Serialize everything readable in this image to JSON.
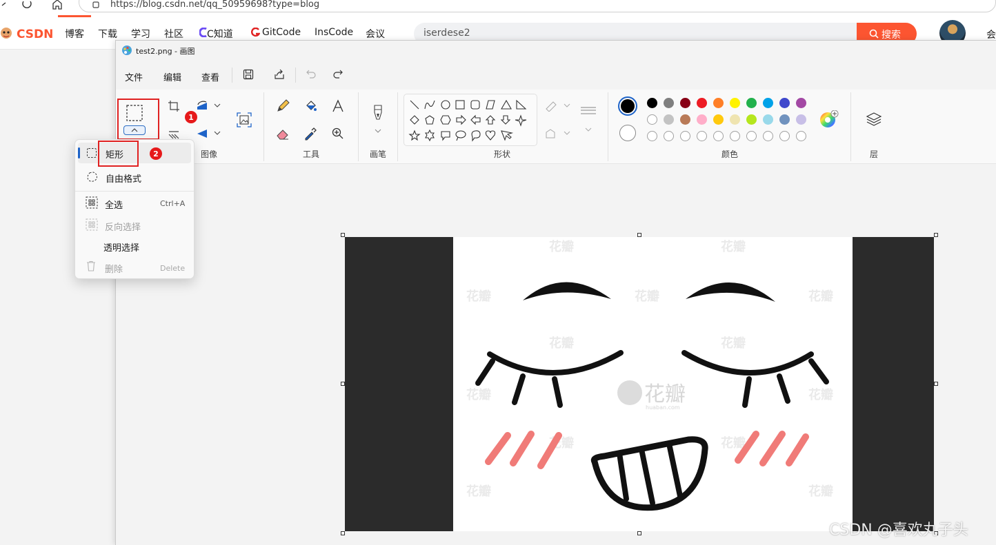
{
  "browser": {
    "url": "https://blog.csdn.net/qq_50959698?type=blog"
  },
  "csdn": {
    "logo_text": "CSDN",
    "nav": [
      "博客",
      "下载",
      "学习",
      "社区",
      "C知道",
      "GitCode",
      "InsCode",
      "会议"
    ],
    "search_value": "iserdese2",
    "search_button": "搜索",
    "right_item": "会",
    "accent_color": "#fc5531"
  },
  "paint": {
    "title": "test2.png - 画图",
    "menus": [
      "文件",
      "编辑",
      "查看"
    ],
    "groups": {
      "image": "图像",
      "tools": "工具",
      "brushes": "画笔",
      "shapes": "形状",
      "colors": "颜色",
      "layers": "层"
    },
    "colors_row1": [
      "#000000",
      "#7f7f7f",
      "#880015",
      "#ed1c24",
      "#ff7f27",
      "#fff200",
      "#22b14c",
      "#00a2e8",
      "#3f48cc",
      "#a349a4"
    ],
    "colors_row2": [
      "#ffffff",
      "#c3c3c3",
      "#b97a57",
      "#ffaec9",
      "#ffc90e",
      "#efe4b0",
      "#b5e61d",
      "#99d9ea",
      "#7092be",
      "#c8bfe7"
    ]
  },
  "selection_menu": {
    "items": [
      {
        "label": "矩形",
        "shortcut": "",
        "icon": "rect-select-icon",
        "disabled": false
      },
      {
        "label": "自由格式",
        "shortcut": "",
        "icon": "freeform-select-icon",
        "disabled": false
      },
      {
        "label": "全选",
        "shortcut": "Ctrl+A",
        "icon": "select-all-icon",
        "disabled": false
      },
      {
        "label": "反向选择",
        "shortcut": "",
        "icon": "invert-select-icon",
        "disabled": true
      },
      {
        "label": "透明选择",
        "shortcut": "",
        "icon": "",
        "disabled": false
      },
      {
        "label": "删除",
        "shortcut": "Delete",
        "icon": "trash-icon",
        "disabled": true
      }
    ]
  },
  "annotations": {
    "badge1": "1",
    "badge2": "2"
  },
  "watermark": {
    "text": "CSDN @喜欢丸子头",
    "image_mark": "花瓣",
    "image_mark_sub": "huaban.com"
  }
}
